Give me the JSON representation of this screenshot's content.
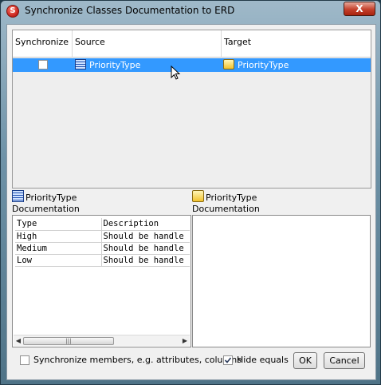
{
  "window": {
    "title": "Synchronize Classes Documentation to ERD",
    "close_glyph": "X"
  },
  "table": {
    "columns": [
      "Synchronize",
      "Source",
      "Target"
    ],
    "rows": [
      {
        "synchronize": false,
        "source": "PriorityType",
        "target": "PriorityType",
        "selected": true
      }
    ]
  },
  "source_panel": {
    "name": "PriorityType",
    "documentation_label": "Documentation",
    "doc_columns": [
      "Type",
      "Description"
    ],
    "doc_rows": [
      [
        "High",
        "Should be handle"
      ],
      [
        "Medium",
        "Should be handle"
      ],
      [
        "Low",
        "Should be handle"
      ]
    ]
  },
  "target_panel": {
    "name": "PriorityType",
    "documentation_label": "Documentation",
    "doc_text": ""
  },
  "footer": {
    "sync_members_label": "Synchronize members, e.g. attributes, columns",
    "sync_members_checked": false,
    "hide_equals_label": "Hide equals",
    "hide_equals_checked": true,
    "ok_label": "OK",
    "cancel_label": "Cancel"
  },
  "icons": {
    "app": "app-logo-icon",
    "source_class": "class-icon-blue",
    "target_entity": "entity-icon-yellow"
  }
}
